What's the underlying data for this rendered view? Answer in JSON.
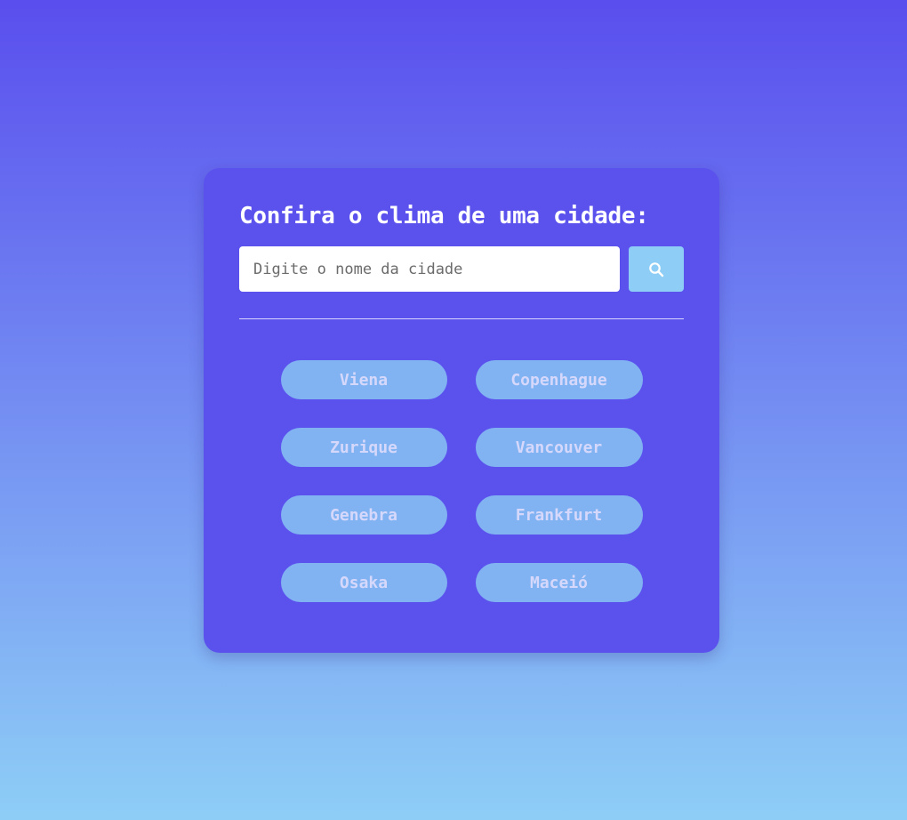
{
  "card": {
    "title": "Confira o clima de uma cidade:"
  },
  "search": {
    "placeholder": "Digite o nome da cidade",
    "value": "",
    "button_icon": "search-icon"
  },
  "cities": [
    {
      "label": "Viena"
    },
    {
      "label": "Copenhague"
    },
    {
      "label": "Zurique"
    },
    {
      "label": "Vancouver"
    },
    {
      "label": "Genebra"
    },
    {
      "label": "Frankfurt"
    },
    {
      "label": "Osaka"
    },
    {
      "label": "Maceió"
    }
  ],
  "colors": {
    "background_top": "#5a4eee",
    "background_bottom": "#8ecef6",
    "card": "#5b52ee",
    "city_button": "#81b3f2",
    "city_text": "#d6d8fb",
    "search_button": "#8ecef6"
  }
}
